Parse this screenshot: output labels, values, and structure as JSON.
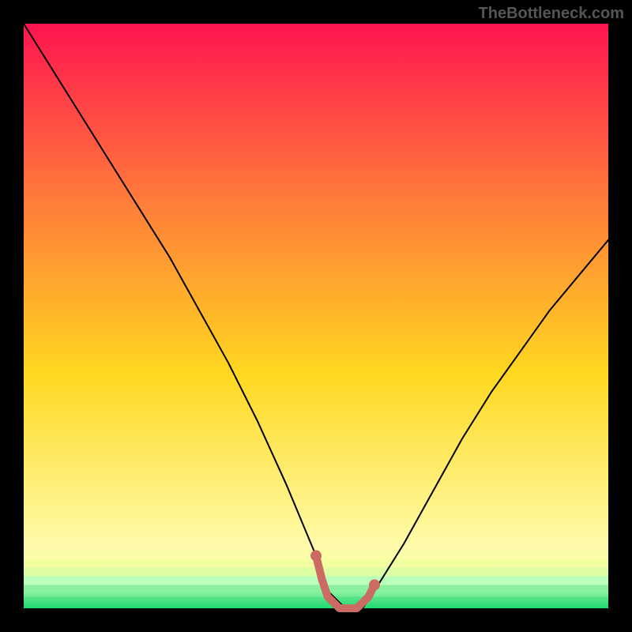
{
  "attribution": "TheBottleneck.com",
  "chart_data": {
    "type": "line",
    "title": "",
    "xlabel": "",
    "ylabel": "",
    "xlim": [
      0,
      100
    ],
    "ylim": [
      0,
      100
    ],
    "background_gradient": {
      "top": "#ff1450",
      "upper_mid": "#ff7b3a",
      "mid": "#ffd820",
      "lower_mid": "#fff89a",
      "bottom": "#20e070"
    },
    "series": [
      {
        "name": "bottleneck-curve",
        "type": "line",
        "color": "#000000",
        "x": [
          0,
          5,
          10,
          15,
          20,
          25,
          30,
          35,
          40,
          45,
          50,
          52,
          55,
          58,
          60,
          65,
          70,
          75,
          80,
          85,
          90,
          95,
          100
        ],
        "values": [
          100,
          92,
          84,
          76,
          68,
          60,
          51,
          42,
          32,
          21,
          9,
          3,
          0,
          0,
          3,
          11,
          20,
          29,
          37,
          44,
          51,
          57,
          63
        ]
      },
      {
        "name": "optimal-zone-marker",
        "type": "line",
        "color": "#cc6b63",
        "thickness": 10,
        "x": [
          50,
          51,
          52,
          53,
          54,
          55,
          56,
          57,
          58,
          59,
          60
        ],
        "values": [
          9,
          5,
          2,
          1,
          0,
          0,
          0,
          0,
          1,
          2,
          4
        ]
      }
    ]
  }
}
